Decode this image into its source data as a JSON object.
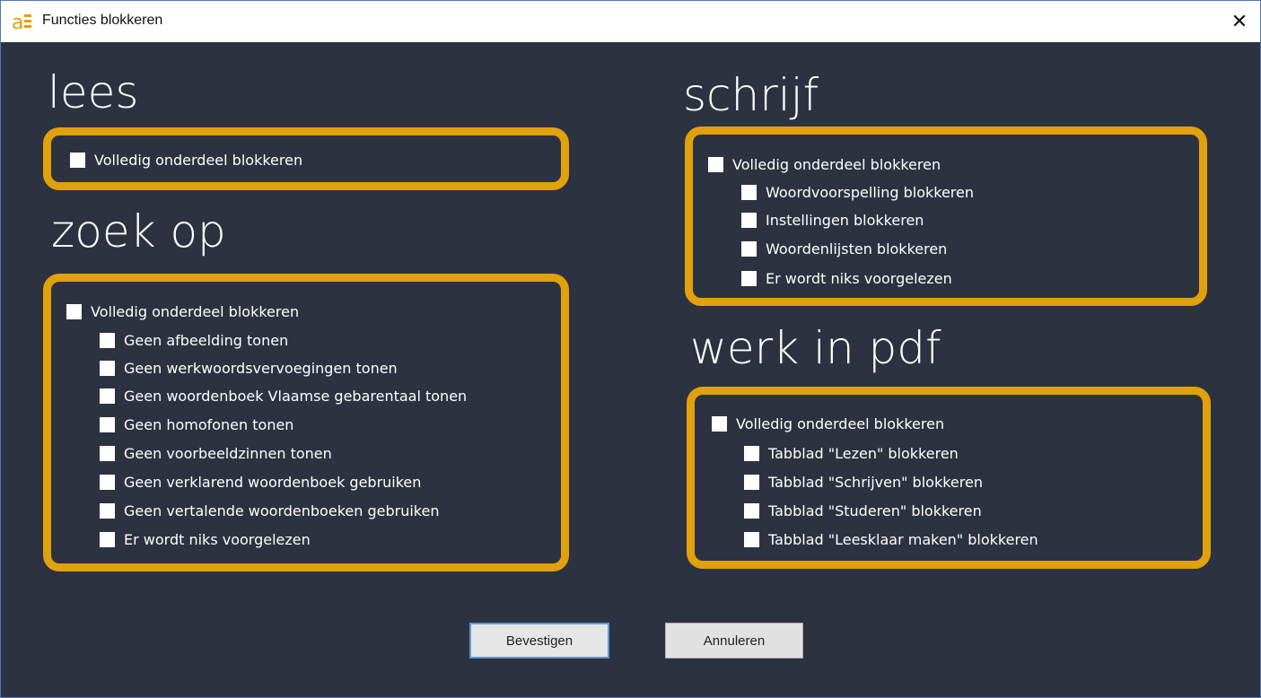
{
  "window": {
    "title": "Functies blokkeren",
    "close_glyph": "✕",
    "accent_color": "#e0a10c",
    "background_color": "#2d3240"
  },
  "lees": {
    "title": "lees",
    "main": "Volledig onderdeel blokkeren"
  },
  "zoek": {
    "title": "zoek op",
    "main": "Volledig onderdeel blokkeren",
    "items": [
      "Geen afbeelding tonen",
      "Geen werkwoordsvervoegingen tonen",
      "Geen woordenboek Vlaamse gebarentaal tonen",
      "Geen homofonen tonen",
      "Geen voorbeeldzinnen tonen",
      "Geen verklarend woordenboek gebruiken",
      "Geen vertalende woordenboeken gebruiken",
      "Er wordt niks voorgelezen"
    ]
  },
  "schrijf": {
    "title": "schrijf",
    "main": "Volledig onderdeel blokkeren",
    "items": [
      "Woordvoorspelling blokkeren",
      "Instellingen blokkeren",
      "Woordenlijsten blokkeren",
      "Er wordt niks voorgelezen"
    ]
  },
  "pdf": {
    "title": "werk in pdf",
    "main": "Volledig onderdeel blokkeren",
    "items": [
      "Tabblad \"Lezen\" blokkeren",
      "Tabblad \"Schrijven\" blokkeren",
      "Tabblad \"Studeren\" blokkeren",
      "Tabblad \"Leesklaar maken\" blokkeren"
    ]
  },
  "buttons": {
    "confirm": "Bevestigen",
    "cancel": "Annuleren"
  }
}
